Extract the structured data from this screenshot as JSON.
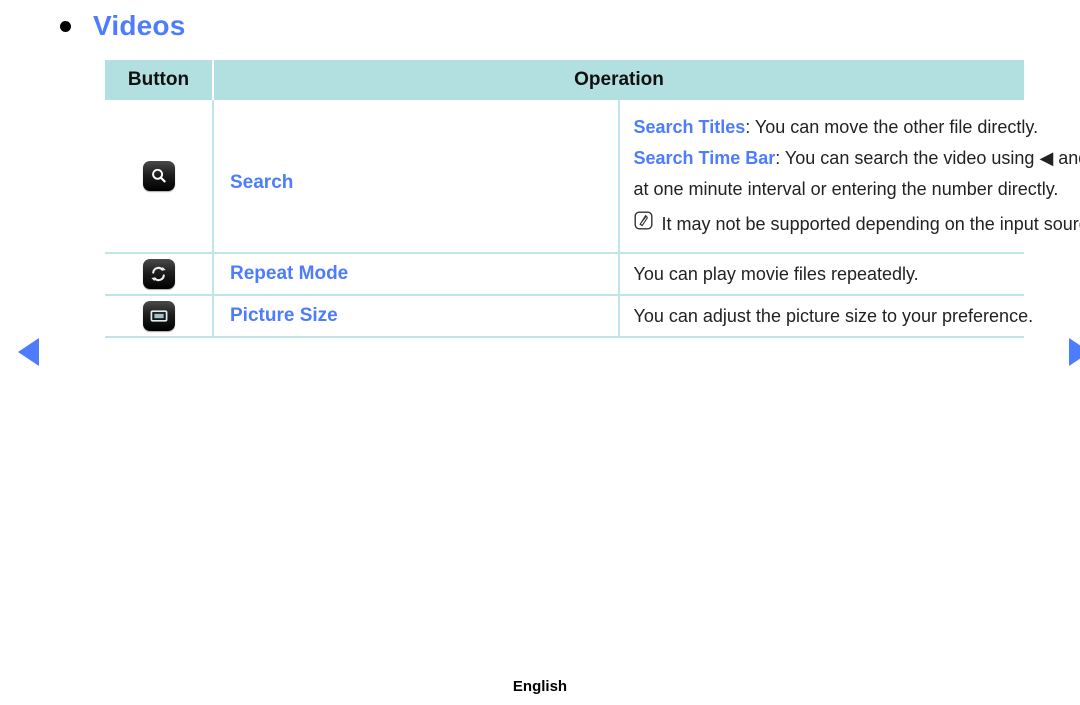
{
  "heading": {
    "bullet_icon": "bullet-dot-icon",
    "text": "Videos"
  },
  "table": {
    "headers": {
      "button": "Button",
      "operation": "Operation"
    },
    "rows": [
      {
        "icon": "search-magnifier-icon",
        "label": "Search",
        "lines": [
          {
            "term": "Search Titles",
            "rest": ": You can move the other file directly."
          },
          {
            "term": "Search Time Bar",
            "rest": ": You can search the video using ◀ and ▶ button"
          },
          {
            "term": "",
            "rest": "at one minute interval or entering the number directly."
          }
        ],
        "note": {
          "icon": "samsung-note-icon",
          "text": "It may not be supported depending on the input source."
        }
      },
      {
        "icon": "repeat-loop-icon",
        "label": "Repeat Mode",
        "description": "You can play movie files repeatedly."
      },
      {
        "icon": "picture-size-icon",
        "label": "Picture Size",
        "description": "You can adjust the picture size to your preference."
      }
    ]
  },
  "navigation": {
    "prev_icon": "triangle-left-icon",
    "next_icon": "triangle-right-icon"
  },
  "footer": {
    "language": "English"
  },
  "colors": {
    "accent_blue": "#4d7cfe",
    "header_teal": "#b2dfe0",
    "border_teal": "#bfe5e8",
    "text_black": "#222222"
  }
}
